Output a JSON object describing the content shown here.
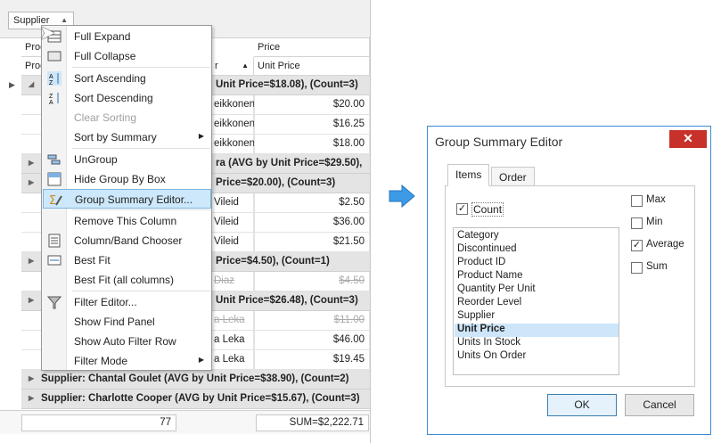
{
  "grid": {
    "group_chip": "Supplier",
    "headers": {
      "band_prod": "Produ",
      "band_price": "Price",
      "col_prod": "Produ",
      "col_r": "r",
      "col_unit_price": "Unit Price"
    },
    "rows": [
      {
        "kind": "group",
        "text": "Unit Price=$18.08), (Count=3)"
      },
      {
        "kind": "data",
        "name": "eikkonen",
        "price": "$20.00"
      },
      {
        "kind": "data",
        "name": "eikkonen",
        "price": "$16.25"
      },
      {
        "kind": "data",
        "name": "eikkonen",
        "price": "$18.00"
      },
      {
        "kind": "group",
        "text": "ra  (AVG by Unit Price=$29.50),"
      },
      {
        "kind": "group",
        "text": "Price=$20.00), (Count=3)"
      },
      {
        "kind": "data",
        "name": "Vileid",
        "price": "$2.50"
      },
      {
        "kind": "data",
        "name": "Vileid",
        "price": "$36.00"
      },
      {
        "kind": "data",
        "name": "Vileid",
        "price": "$21.50"
      },
      {
        "kind": "group",
        "text": "Price=$4.50), (Count=1)"
      },
      {
        "kind": "data_strike",
        "name": "Diaz",
        "price": "$4.50"
      },
      {
        "kind": "group",
        "text": "Unit Price=$26.48), (Count=3)"
      },
      {
        "kind": "data_strike",
        "name": "a Leka",
        "price": "$11.00"
      },
      {
        "kind": "data",
        "name": "a Leka",
        "price": "$46.00"
      },
      {
        "kind": "data",
        "name": "a Leka",
        "price": "$19.45"
      },
      {
        "kind": "group_full",
        "text": "Supplier: Chantal Goulet (AVG by Unit Price=$38.90), (Count=2)"
      },
      {
        "kind": "group_full",
        "text": "Supplier: Charlotte Cooper (AVG by Unit Price=$15.67), (Count=3)"
      }
    ],
    "footer": {
      "count": "77",
      "sum": "SUM=$2,222.71"
    }
  },
  "context_menu": {
    "items": [
      {
        "label": "Full Expand",
        "icon": "expand-icon"
      },
      {
        "label": "Full Collapse",
        "icon": "collapse-icon"
      },
      {
        "label": "Sort Ascending",
        "icon": "sort-ascending-icon"
      },
      {
        "label": "Sort Descending",
        "icon": "sort-descending-icon"
      },
      {
        "label": "Clear Sorting",
        "icon": "",
        "disabled": true
      },
      {
        "label": "Sort by Summary",
        "icon": "",
        "submenu": true
      },
      {
        "label": "UnGroup",
        "icon": "ungroup-icon"
      },
      {
        "label": "Hide Group By Box",
        "icon": "group-box-icon"
      },
      {
        "label": "Group Summary Editor...",
        "icon": "summary-editor-icon",
        "selected": true
      },
      {
        "label": "Remove This Column",
        "icon": ""
      },
      {
        "label": "Column/Band Chooser",
        "icon": "column-chooser-icon"
      },
      {
        "label": "Best Fit",
        "icon": "best-fit-icon"
      },
      {
        "label": "Best Fit (all columns)",
        "icon": ""
      },
      {
        "label": "Filter Editor...",
        "icon": "filter-icon"
      },
      {
        "label": "Show Find Panel",
        "icon": ""
      },
      {
        "label": "Show Auto Filter Row",
        "icon": ""
      },
      {
        "label": "Filter Mode",
        "icon": "",
        "submenu": true
      }
    ]
  },
  "dialog": {
    "title": "Group Summary Editor",
    "close_glyph": "✕",
    "tabs": [
      "Items",
      "Order"
    ],
    "count_label": "Count",
    "fields": [
      "Category",
      "Discontinued",
      "Product ID",
      "Product Name",
      "Quantity Per Unit",
      "Reorder Level",
      "Supplier",
      "Unit Price",
      "Units In Stock",
      "Units On Order"
    ],
    "selected_field": "Unit Price",
    "options": [
      {
        "label": "Max",
        "checked": false
      },
      {
        "label": "Min",
        "checked": false
      },
      {
        "label": "Average",
        "checked": true
      },
      {
        "label": "Sum",
        "checked": false
      }
    ],
    "ok_label": "OK",
    "cancel_label": "Cancel"
  },
  "colors": {
    "accent": "#3a8ad8",
    "close": "#c7312a",
    "selection": "#cde8fb"
  }
}
